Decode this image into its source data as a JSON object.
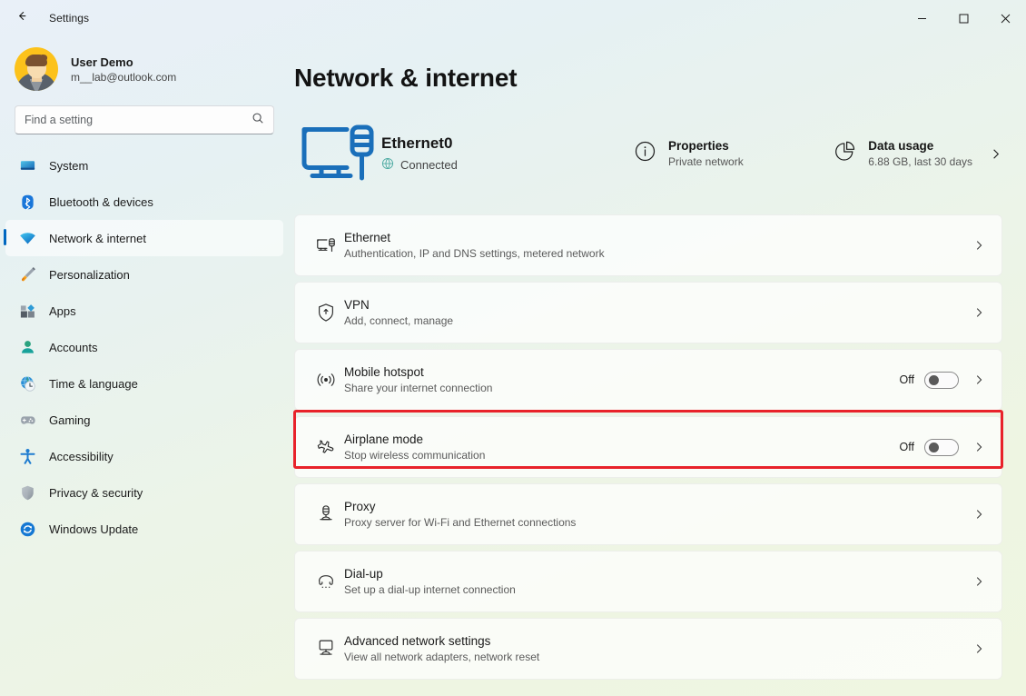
{
  "window": {
    "title": "Settings",
    "back_icon": "back-arrow-icon",
    "controls": {
      "minimize": "minimize-icon",
      "maximize": "maximize-icon",
      "close": "close-icon"
    }
  },
  "sidebar": {
    "account": {
      "name": "User Demo",
      "email": "m__lab@outlook.com",
      "avatar": "user-avatar"
    },
    "search": {
      "placeholder": "Find a setting",
      "value": "",
      "icon": "search-icon"
    },
    "items": [
      {
        "label": "System",
        "icon": "monitor-icon",
        "active": false
      },
      {
        "label": "Bluetooth & devices",
        "icon": "bluetooth-icon",
        "active": false
      },
      {
        "label": "Network & internet",
        "icon": "wifi-icon",
        "active": true
      },
      {
        "label": "Personalization",
        "icon": "paintbrush-icon",
        "active": false
      },
      {
        "label": "Apps",
        "icon": "apps-grid-icon",
        "active": false
      },
      {
        "label": "Accounts",
        "icon": "person-icon",
        "active": false
      },
      {
        "label": "Time & language",
        "icon": "clock-globe-icon",
        "active": false
      },
      {
        "label": "Gaming",
        "icon": "gamepad-icon",
        "active": false
      },
      {
        "label": "Accessibility",
        "icon": "accessibility-person-icon",
        "active": false
      },
      {
        "label": "Privacy & security",
        "icon": "shield-icon",
        "active": false
      },
      {
        "label": "Windows Update",
        "icon": "update-refresh-icon",
        "active": false
      }
    ]
  },
  "main": {
    "page_title": "Network & internet",
    "hero": {
      "icon": "monitor-ethernet-icon",
      "name": "Ethernet0",
      "status": "Connected",
      "status_icon": "globe-icon",
      "actions": [
        {
          "title": "Properties",
          "subtitle": "Private network",
          "icon": "info-circle-icon"
        },
        {
          "title": "Data usage",
          "subtitle": "6.88 GB, last 30 days",
          "icon": "pie-chart-icon"
        }
      ],
      "chevron": "chevron-right-icon"
    },
    "cards": [
      {
        "title": "Ethernet",
        "subtitle": "Authentication, IP and DNS settings, metered network",
        "icon": "ethernet-port-icon",
        "toggle": null,
        "highlighted": false
      },
      {
        "title": "VPN",
        "subtitle": "Add, connect, manage",
        "icon": "vpn-shield-icon",
        "toggle": null,
        "highlighted": false
      },
      {
        "title": "Mobile hotspot",
        "subtitle": "Share your internet connection",
        "icon": "hotspot-broadcast-icon",
        "toggle": {
          "state": "Off",
          "on": false
        },
        "highlighted": false
      },
      {
        "title": "Airplane mode",
        "subtitle": "Stop wireless communication",
        "icon": "airplane-icon",
        "toggle": {
          "state": "Off",
          "on": false
        },
        "highlighted": true
      },
      {
        "title": "Proxy",
        "subtitle": "Proxy server for Wi-Fi and Ethernet connections",
        "icon": "proxy-server-icon",
        "toggle": null,
        "highlighted": false
      },
      {
        "title": "Dial-up",
        "subtitle": "Set up a dial-up internet connection",
        "icon": "dialup-phone-icon",
        "toggle": null,
        "highlighted": false
      },
      {
        "title": "Advanced network settings",
        "subtitle": "View all network adapters, network reset",
        "icon": "advanced-network-icon",
        "toggle": null,
        "highlighted": false
      }
    ]
  },
  "colors": {
    "accent": "#0067c0",
    "highlight": "#e8222a",
    "text_primary": "#1b1b1b",
    "text_secondary": "#5a5a5a"
  }
}
